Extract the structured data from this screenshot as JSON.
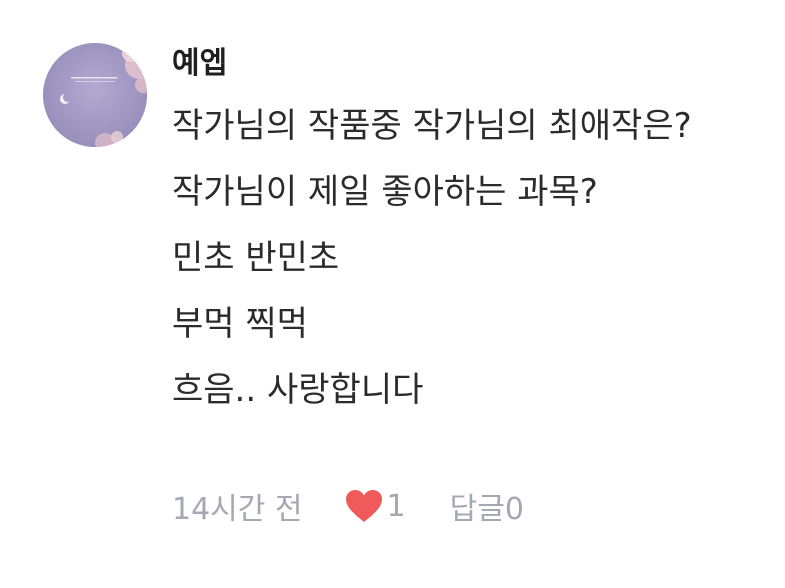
{
  "comment": {
    "author": "예엡",
    "lines": [
      "작가님의 작품중 작가님의 최애작은?",
      "작가님이 제일 좋아하는 과목?",
      "민초 반민초",
      "부먹 찍먹",
      "흐음.. 사랑합니다"
    ],
    "time": "14시간 전",
    "like_count": "1",
    "reply_label": "답글",
    "reply_count": "0"
  },
  "colors": {
    "heart": "#f05a5a",
    "meta_text": "#a3a8b3",
    "avatar_bg": "#a39bc4"
  },
  "icons": {
    "avatar": "profile-avatar-image",
    "like": "heart-icon"
  }
}
